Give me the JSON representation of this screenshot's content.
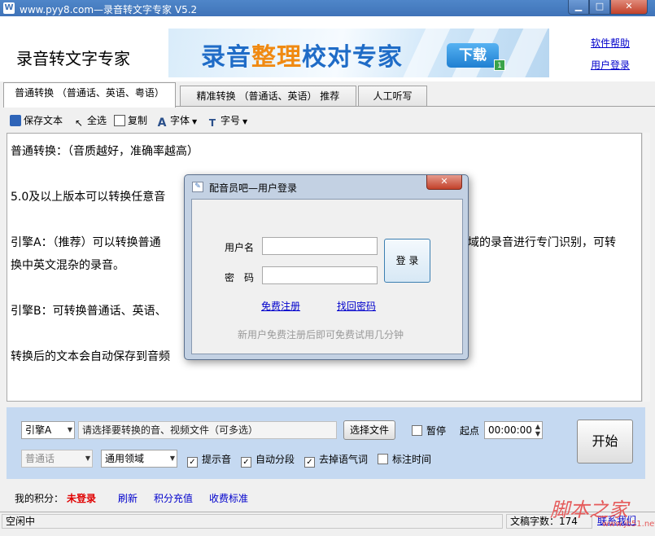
{
  "window": {
    "title": "www.pyy8.com—录音转文字专家 V5.2",
    "minimize_glyph": "▁",
    "maximize_glyph": "□",
    "close_glyph": "✕"
  },
  "header": {
    "app_name": "录音转文字专家",
    "banner_text_a": "录音",
    "banner_text_b": "整理",
    "banner_text_c": "校对专家",
    "banner_button": "下载",
    "banner_badge": "1",
    "help_link": "软件帮助",
    "login_link": "用户登录"
  },
  "tabs": [
    {
      "label": "普通转换 （普通话、英语、粤语）"
    },
    {
      "label": "精准转换 （普通话、英语） 推荐"
    },
    {
      "label": "人工听写"
    }
  ],
  "toolbar": {
    "save": "保存文本",
    "select_all": "全选",
    "copy": "复制",
    "font": "字体",
    "font_size": "字号"
  },
  "editor": {
    "lines": [
      "普通转换：（音质越好，准确率越高）",
      "5.0及以上版本可以转换任意音",
      "引擎A：（推荐）可以转换普通",
      "域的录音进行专门识别，可转",
      "换中英文混杂的录音。",
      "引擎B：可转换普通话、英语、",
      "转换后的文本会自动保存到音频"
    ]
  },
  "controls": {
    "engine": "引擎A",
    "file_placeholder": "请选择要转换的音、视频文件（可多选）",
    "choose_file": "选择文件",
    "pause": "暂停",
    "start_point_label": "起点",
    "start_time": "00:00:00",
    "language": "普通话",
    "domain": "通用领域",
    "beep": "提示音",
    "auto_segment": "自动分段",
    "remove_fillers": "去掉语气词",
    "timestamps": "标注时间",
    "start_button": "开始"
  },
  "info": {
    "points_label": "我的积分：",
    "login_status": "未登录",
    "refresh": "刷新",
    "recharge": "积分充值",
    "pricing": "收费标准"
  },
  "status": {
    "state": "空闲中",
    "char_count_label": "文稿字数：",
    "char_count": "174",
    "contact": "联系我们"
  },
  "watermark": {
    "text": "脚本之家",
    "url": "www.jb51.net"
  },
  "dialog": {
    "title": "配音员吧—用户登录",
    "username_label": "用户名",
    "password_label": "密　码",
    "login_button": "登 录",
    "register_link": "免费注册",
    "recover_link": "找回密码",
    "hint": "新用户免费注册后即可免费试用几分钟",
    "close_glyph": "✕"
  },
  "colors": {
    "titlebar": "#4f86c9",
    "panel": "#c5d9f1",
    "link": "#0000cc",
    "alert": "#e00000",
    "banner_blue": "#1f6cc7",
    "banner_orange": "#f08a12"
  }
}
